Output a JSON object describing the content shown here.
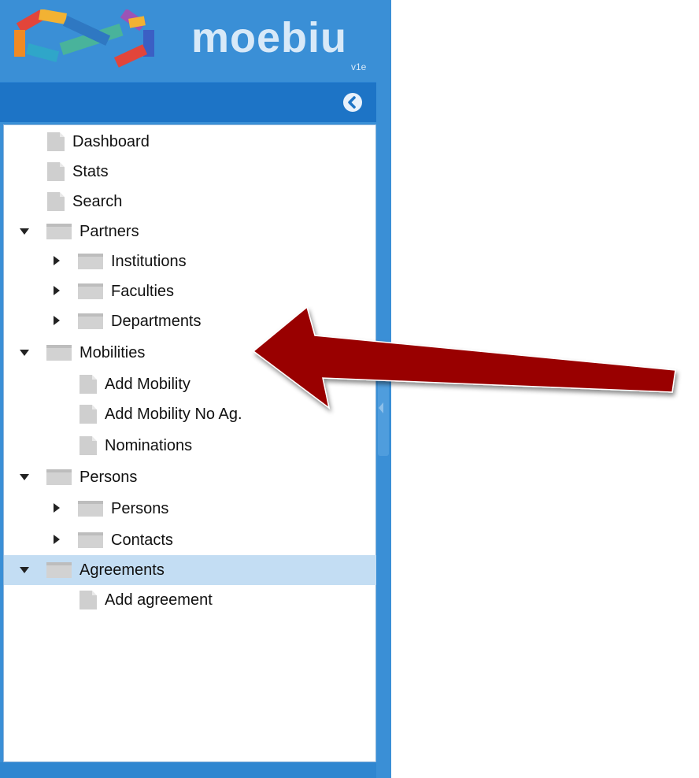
{
  "app": {
    "logo_text": "moebiu",
    "logo_sub": "v1e",
    "accent": "#3a8fd6",
    "header_color": "#1d74c6"
  },
  "sidebar": {
    "collapse_icon": "chevron-left-circle-icon",
    "tree": [
      {
        "label": "Dashboard",
        "type": "file",
        "level": 0
      },
      {
        "label": "Stats",
        "type": "file",
        "level": 0
      },
      {
        "label": "Search",
        "type": "file",
        "level": 0
      },
      {
        "label": "Partners",
        "type": "folder",
        "level": 0,
        "expanded": true
      },
      {
        "label": "Institutions",
        "type": "folder",
        "level": 1,
        "expanded": false
      },
      {
        "label": "Faculties",
        "type": "folder",
        "level": 1,
        "expanded": false
      },
      {
        "label": "Departments",
        "type": "folder",
        "level": 1,
        "expanded": false
      },
      {
        "label": "Mobilities",
        "type": "folder",
        "level": 0,
        "expanded": true
      },
      {
        "label": "Add Mobility",
        "type": "file",
        "level": 1
      },
      {
        "label": "Add Mobility No Ag.",
        "type": "file",
        "level": 1
      },
      {
        "label": "Nominations",
        "type": "file",
        "level": 1
      },
      {
        "label": "Persons",
        "type": "folder",
        "level": 0,
        "expanded": true
      },
      {
        "label": "Persons",
        "type": "folder",
        "level": 1,
        "expanded": false
      },
      {
        "label": "Contacts",
        "type": "folder",
        "level": 1,
        "expanded": false
      },
      {
        "label": "Agreements",
        "type": "folder",
        "level": 0,
        "expanded": true,
        "selected": true
      },
      {
        "label": "Add agreement",
        "type": "file",
        "level": 1
      }
    ],
    "selected_color": "#c3ddf3"
  },
  "annotation": {
    "arrow_color": "#990000",
    "arrow_icon": "large-red-arrow-pointing-left"
  }
}
